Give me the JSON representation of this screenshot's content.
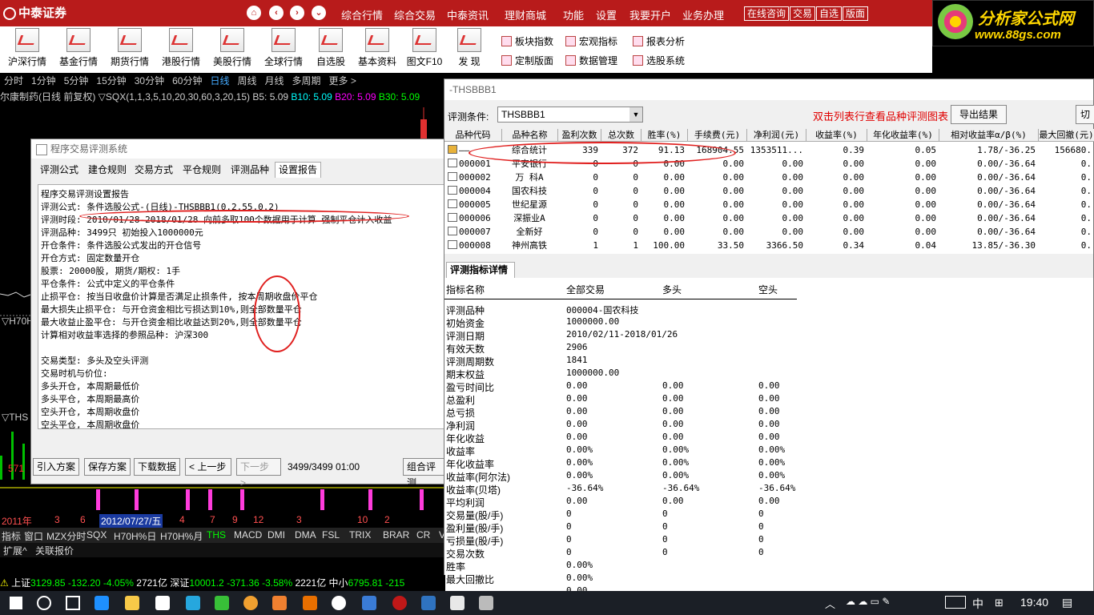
{
  "app": {
    "brand": "中泰证券"
  },
  "topmenu": [
    "综合行情",
    "综合交易",
    "中泰资讯",
    "理财商城",
    "功能",
    "设置",
    "我要开户",
    "业务办理"
  ],
  "topbuttons": [
    "在线咨询",
    "交易",
    "自选",
    "版面"
  ],
  "ad": {
    "line1": "分析家公式网",
    "line2": "www.88gs.com"
  },
  "toolbar": [
    "沪深行情",
    "基金行情",
    "期货行情",
    "港股行情",
    "美股行情",
    "全球行情",
    "自选股",
    "基本资料",
    "图文F10",
    "发  现"
  ],
  "toolbar_side": [
    [
      "板块指数",
      "宏观指标",
      "报表分析"
    ],
    [
      "定制版面",
      "数据管理",
      "选股系统"
    ]
  ],
  "periods": [
    "分时",
    "1分钟",
    "5分钟",
    "15分钟",
    "30分钟",
    "60分钟",
    "日线",
    "周线",
    "月线",
    "多周期",
    "更多 >"
  ],
  "chart_header": "尔康制药(日线 前复权) ▽SQX(1,1,3,5,10,20,30,60,3,20,15)  B5: 5.09",
  "chart_header_b": [
    "B10: 5.09",
    "B20: 5.09",
    "B30: 5.09"
  ],
  "chart_side": [
    "▽H70H",
    "▽THS",
    "571"
  ],
  "date_axis": [
    "2011年",
    "3",
    "6",
    "2012/07/27/五",
    "4",
    "7",
    "9",
    "12",
    "3",
    "10",
    "2"
  ],
  "indicator_tabs": [
    "指标",
    "窗口",
    "MZX分时",
    "SQX",
    "H70H%日",
    "H70H%月",
    "THS",
    "MACD",
    "DMI",
    "DMA",
    "FSL",
    "TRIX",
    "BRAR",
    "CR",
    "VR"
  ],
  "ext_tabs": [
    "扩展^",
    "关联报价"
  ],
  "eval_window": {
    "title": "程序交易评测系统",
    "tabs": [
      "评测公式",
      "建仓规则",
      "交易方式",
      "平仓规则",
      "评测品种",
      "设置报告"
    ],
    "report": [
      "                 程序交易评测设置报告",
      "评测公式: 条件选股公式-(日线)-THSBBB1(0.2,55,0.2)",
      "评测时段: 2010/01/28-2018/01/28 向前多取100个数据用于计算 强制平仓计入收益",
      "评测品种: 3499只 初始投入1000000元",
      "开仓条件: 条件选股公式发出的开仓信号",
      "开仓方式: 固定数量开仓",
      "         股票: 20000股, 期货/期权: 1手",
      "平仓条件: 公式中定义的平仓条件",
      "止损平仓: 按当日收盘价计算是否满足止损条件, 按本周期收盘价平仓",
      "         最大损失止损平仓: 与开仓资金相比亏损达到10%,则全部数量平仓",
      "         最大收益止盈平仓: 与开仓资金相比收益达到20%,则全部数量平仓",
      "         计算相对收益率选择的参照品种: 沪深300",
      "",
      "交易类型: 多头及空头评测",
      "交易时机与价位:",
      "         多头开仓, 本周期最低价",
      "         多头平仓, 本周期最高价",
      "         空头开仓, 本周期收盘价",
      "         空头平仓, 本周期收盘价"
    ],
    "buttons": [
      "引入方案",
      "保存方案",
      "下载数据",
      "< 上一步",
      "下一步 >",
      "组合评测"
    ],
    "progress": "3499/3499 01:00"
  },
  "ths_window": {
    "title": "-THSBBB1",
    "cond_label": "评测条件:",
    "cond_value": "THSBBB1",
    "hint": "双击列表行查看品种评测图表",
    "export": "导出结果",
    "switch": "切换",
    "columns": [
      "品种代码",
      "品种名称",
      "盈利次数",
      "总次数",
      "胜率(%)",
      "手续费(元)",
      "净利润(元)",
      "收益率(%)",
      "年化收益率(%)",
      "相对收益率α/β(%)",
      "最大回撤(元)"
    ],
    "rows": [
      [
        "——",
        "综合统计",
        "339",
        "372",
        "91.13",
        "168904.55",
        "1353511...",
        "0.39",
        "0.05",
        "1.78/-36.25",
        "156680."
      ],
      [
        "000001",
        "平安银行",
        "0",
        "0",
        "0.00",
        "0.00",
        "0.00",
        "0.00",
        "0.00",
        "0.00/-36.64",
        "0."
      ],
      [
        "000002",
        "万 科A",
        "0",
        "0",
        "0.00",
        "0.00",
        "0.00",
        "0.00",
        "0.00",
        "0.00/-36.64",
        "0."
      ],
      [
        "000004",
        "国农科技",
        "0",
        "0",
        "0.00",
        "0.00",
        "0.00",
        "0.00",
        "0.00",
        "0.00/-36.64",
        "0."
      ],
      [
        "000005",
        "世纪星源",
        "0",
        "0",
        "0.00",
        "0.00",
        "0.00",
        "0.00",
        "0.00",
        "0.00/-36.64",
        "0."
      ],
      [
        "000006",
        "深振业A",
        "0",
        "0",
        "0.00",
        "0.00",
        "0.00",
        "0.00",
        "0.00",
        "0.00/-36.64",
        "0."
      ],
      [
        "000007",
        "全新好",
        "0",
        "0",
        "0.00",
        "0.00",
        "0.00",
        "0.00",
        "0.00",
        "0.00/-36.64",
        "0."
      ],
      [
        "000008",
        "神州高铁",
        "1",
        "1",
        "100.00",
        "33.50",
        "3366.50",
        "0.34",
        "0.04",
        "13.85/-36.30",
        "0."
      ]
    ],
    "detail_tab": "评测指标详情",
    "detail_cols": [
      "指标名称",
      "全部交易",
      "多头",
      "空头"
    ],
    "detail_rows": [
      [
        "评测品种",
        "000004-国农科技",
        "",
        ""
      ],
      [
        "初始资金",
        "1000000.00",
        "",
        ""
      ],
      [
        "评测日期",
        "2010/02/11-2018/01/26",
        "",
        ""
      ],
      [
        "有效天数",
        "2906",
        "",
        ""
      ],
      [
        "评测周期数",
        "1841",
        "",
        ""
      ],
      [
        "期末权益",
        "1000000.00",
        "",
        ""
      ],
      [
        "盈亏时间比",
        "0.00",
        "0.00",
        "0.00"
      ],
      [
        "总盈利",
        "0.00",
        "0.00",
        "0.00"
      ],
      [
        "总亏损",
        "0.00",
        "0.00",
        "0.00"
      ],
      [
        "净利润",
        "0.00",
        "0.00",
        "0.00"
      ],
      [
        "年化收益",
        "0.00",
        "0.00",
        "0.00"
      ],
      [
        "收益率",
        "0.00%",
        "0.00%",
        "0.00%"
      ],
      [
        "年化收益率",
        "0.00%",
        "0.00%",
        "0.00%"
      ],
      [
        "收益率(阿尔法)",
        "0.00%",
        "0.00%",
        "0.00%"
      ],
      [
        "收益率(贝塔)",
        "-36.64%",
        "-36.64%",
        "-36.64%"
      ],
      [
        "平均利润",
        "0.00",
        "0.00",
        "0.00"
      ],
      [
        "交易量(股/手)",
        "0",
        "0",
        "0"
      ],
      [
        "盈利量(股/手)",
        "0",
        "0",
        "0"
      ],
      [
        "亏损量(股/手)",
        "0",
        "0",
        "0"
      ],
      [
        "交易次数",
        "0",
        "0",
        "0"
      ],
      [
        "胜率",
        "0.00%",
        "",
        ""
      ],
      [
        "最大回撤比",
        "0.00%",
        "",
        ""
      ],
      [
        "",
        "0.00",
        "",
        ""
      ]
    ]
  },
  "statusbar": {
    "sh": "上证",
    "sh_v": "3129.85",
    "sh_c": "-132.20",
    "sh_p": "-4.05%",
    "sh_a": "2721亿",
    "sz": "深证",
    "sz_v": "10001.2",
    "sz_c": "-371.36",
    "sz_p": "-3.58%",
    "sz_a": "2221亿",
    "zx": "中小",
    "zx_v": "6795.81",
    "zx_c": "-215"
  },
  "tray": {
    "ime": "中",
    "time": "19:40"
  },
  "colors": {
    "red": "#b81b1b",
    "annot": "#e0201f",
    "green": "#00c000",
    "magenta": "#ff3cdc"
  }
}
